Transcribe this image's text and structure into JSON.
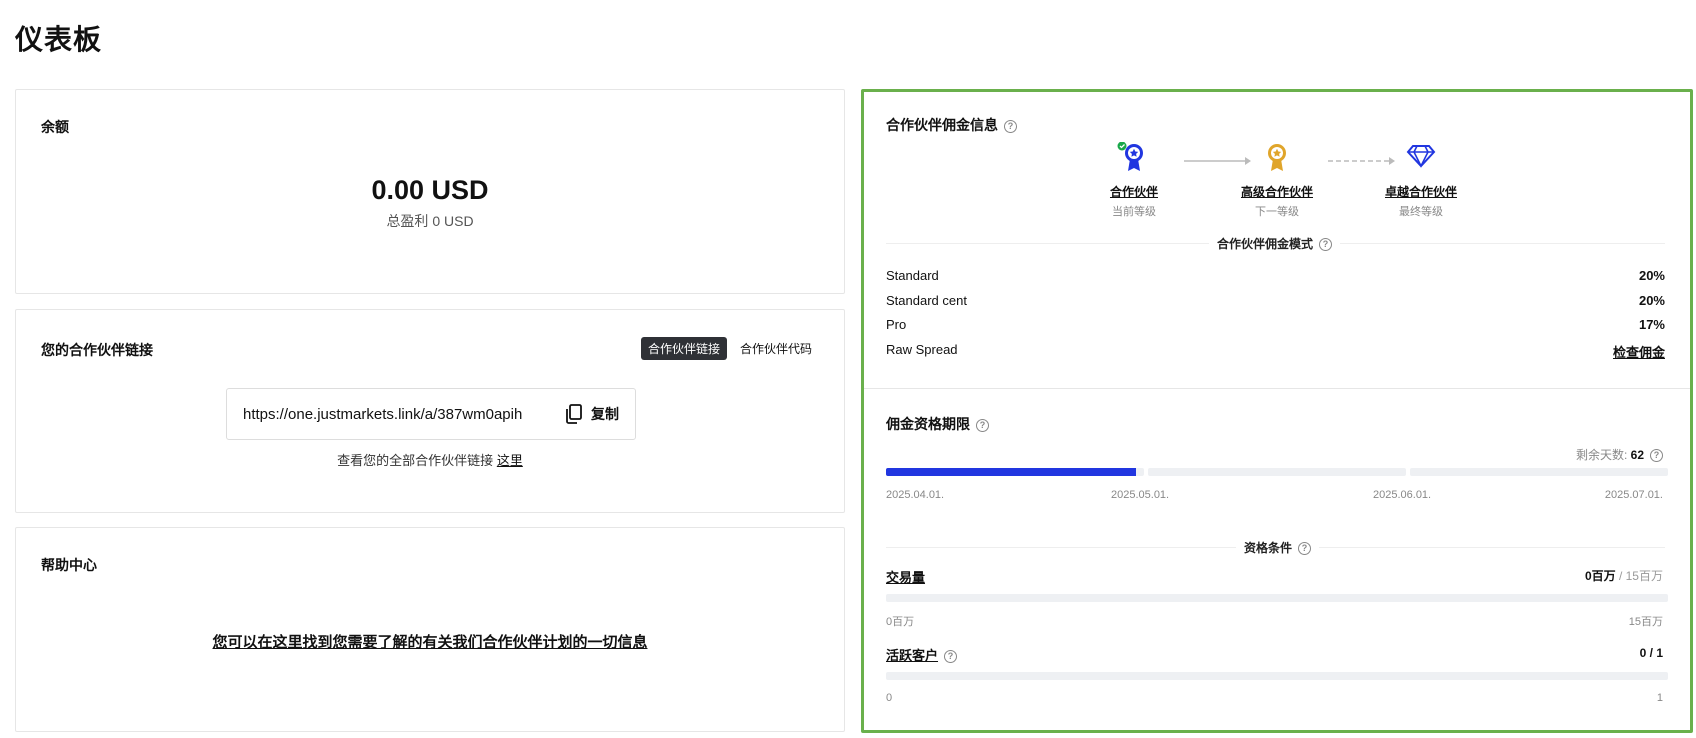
{
  "page": {
    "title": "仪表板"
  },
  "balance": {
    "title": "余额",
    "amount": "0.00 USD",
    "total_profit": "总盈利 0 USD"
  },
  "links": {
    "title": "您的合作伙伴链接",
    "tabs": [
      {
        "label": "合作伙伴链接",
        "active": true
      },
      {
        "label": "合作伙伴代码",
        "active": false
      }
    ],
    "url": "https://one.justmarkets.link/a/387wm0apih",
    "copy_label": "复制",
    "note_prefix": "查看您的全部合作伙伴链接",
    "note_link": "这里"
  },
  "help": {
    "title": "帮助中心",
    "link_text": "您可以在这里找到您需要了解的有关我们合作伙伴计划的一切信息"
  },
  "partner": {
    "title": "合作伙伴佣金信息",
    "tiers": [
      {
        "name": "合作伙伴",
        "status": "当前等级",
        "color": "#2136e0"
      },
      {
        "name": "高级合作伙伴",
        "status": "下一等级",
        "color": "#e0a52a"
      },
      {
        "name": "卓越合作伙伴",
        "status": "最终等级",
        "color": "#2136e0"
      }
    ],
    "model_label": "合作伙伴佣金模式",
    "rates": [
      {
        "name": "Standard",
        "value": "20%"
      },
      {
        "name": "Standard cent",
        "value": "20%"
      },
      {
        "name": "Pro",
        "value": "17%"
      },
      {
        "name": "Raw Spread",
        "value": "检查佣金"
      }
    ]
  },
  "period": {
    "title": "佣金资格期限",
    "days_label": "剩余天数:",
    "days_value": "62",
    "progress_first_segment": 0.97,
    "dates": [
      "2025.04.01.",
      "2025.05.01.",
      "2025.06.01.",
      "2025.07.01."
    ]
  },
  "conditions": {
    "label": "资格条件",
    "volume": {
      "title": "交易量",
      "current": "0百万",
      "max": "/ 15百万",
      "min_label": "0百万",
      "max_label": "15百万",
      "progress": 0
    },
    "clients": {
      "title": "活跃客户",
      "value": "0 / 1",
      "min_label": "0",
      "max_label": "1",
      "progress": 0
    }
  },
  "colors": {
    "accent": "#2136e0",
    "highlight_border": "#6ab04c",
    "gold": "#e0a52a",
    "check": "#1aa84a"
  }
}
